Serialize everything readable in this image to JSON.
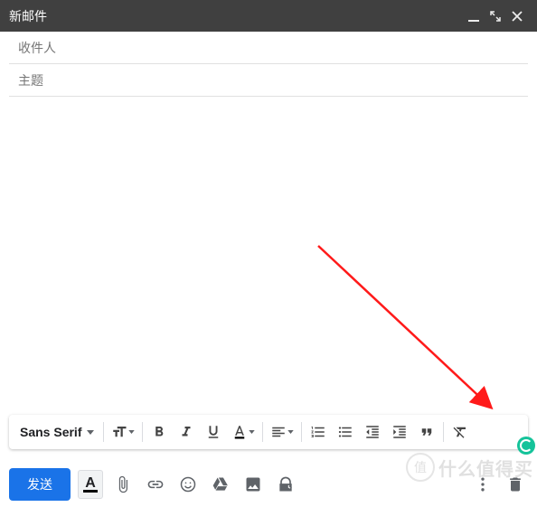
{
  "titlebar": {
    "title": "新邮件"
  },
  "fields": {
    "recipients_placeholder": "收件人",
    "subject_placeholder": "主题"
  },
  "format_toolbar": {
    "font_name": "Sans Serif"
  },
  "bottom": {
    "send_label": "发送",
    "text_color_glyph": "A"
  },
  "watermark": {
    "circ": "值",
    "text": "什么值得买"
  }
}
